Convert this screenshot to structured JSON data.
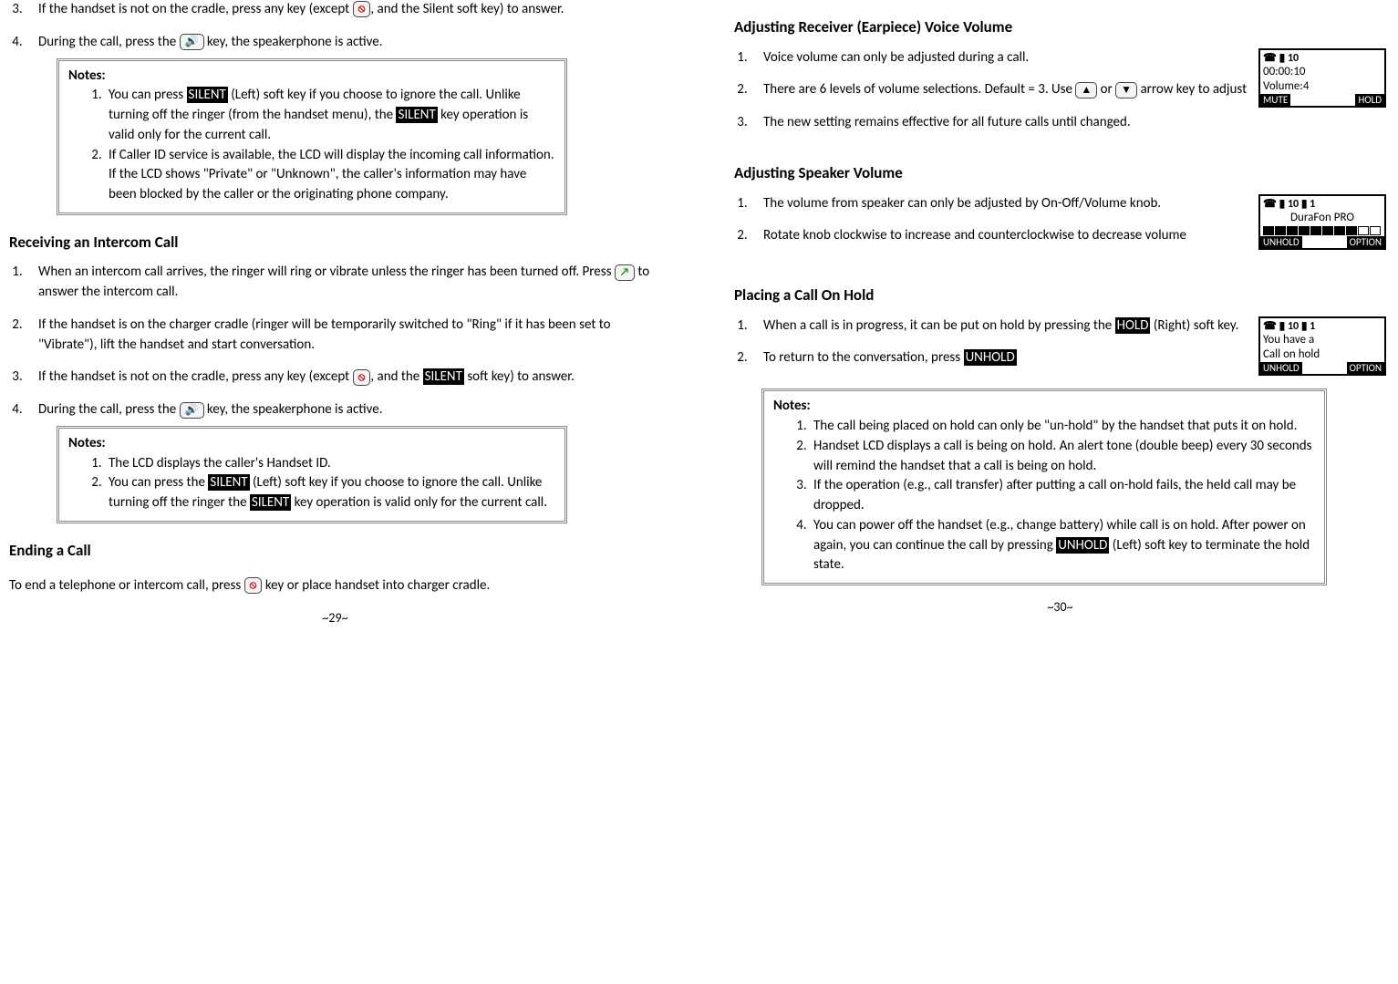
{
  "left": {
    "item3": {
      "pre": "If the handset is not on the cradle, press any key (except ",
      "post": ", and the Silent soft key) to answer."
    },
    "item4": {
      "pre": "During the call, press the ",
      "post": " key, the speakerphone is active."
    },
    "notes1": {
      "title": "Notes:",
      "i1a": "You can press ",
      "silent": "SILENT",
      "i1b": " (Left) soft key if you choose to ignore the call.  Unlike turning off the ringer (from the handset menu), the ",
      "i1c": " key operation is valid only for the current call.",
      "i2": "If Caller ID service is available, the LCD will display the incoming call information.  If the LCD shows \"Private\" or \"Unknown\", the caller's information may have been blocked by the caller or the originating phone company."
    },
    "h_intercom": "Receiving an Intercom Call",
    "ic1a": "When an intercom call arrives, the ringer will ring or vibrate unless the ringer has been turned off. Press ",
    "ic1b": " to answer the intercom call.",
    "ic2": "If the handset is on the charger cradle (ringer will be temporarily switched to \"Ring\" if it has been set to \"Vibrate\"), lift the handset and start conversation.",
    "ic3a": "If the handset is not on the cradle, press any key (except ",
    "ic3b": ", and the ",
    "ic3c": " soft key) to answer.",
    "ic4a": "During the call, press the ",
    "ic4b": " key, the speakerphone is active.",
    "notes2": {
      "title": "Notes:",
      "i1": "The LCD displays the caller's Handset ID.",
      "i2a": "You can press the ",
      "i2b": " (Left) soft key if you choose to ignore the call.  Unlike turning off the ringer the ",
      "i2c": " key operation is valid only for the current call."
    },
    "h_end": "Ending a Call",
    "end_a": "To end a telephone or intercom call, press ",
    "end_b": " key or place handset into charger cradle.",
    "foot": "~29~"
  },
  "right": {
    "h_recv": "Adjusting Receiver (Earpiece) Voice Volume",
    "r1": "Voice volume can only be adjusted during a call.",
    "r2a": "There are 6 levels of volume selections.  Default = 3. Use ",
    "r2b": " or ",
    "r2c": " arrow key to adjust",
    "r3": "The new setting remains effective for all future calls until changed.",
    "lcd1": {
      "top": "☎ ▮ 10",
      "l2": "00:00:10",
      "l3": "Volume:4",
      "skL": "MUTE",
      "skR": "HOLD"
    },
    "h_speak": "Adjusting Speaker Volume",
    "s1": "The volume from speaker can only be adjusted by On-Off/Volume knob.",
    "s2": "Rotate knob clockwise to increase and counterclockwise to decrease volume",
    "lcd2": {
      "top": "☎ ▮ 10 ▮ 1",
      "l2": "DuraFon PRO",
      "skL": "UNHOLD",
      "skR": "OPTION"
    },
    "h_hold": "Placing a Call On Hold",
    "h1a": "When a call is in progress, it can be put on hold by pressing the ",
    "hold": "HOLD",
    "h1b": " (Right) soft key.",
    "h2a": "To return to the conversation, press ",
    "unhold": "UNHOLD",
    "lcd3": {
      "top": "☎ ▮ 10 ▮ 1",
      "l2": "You have a",
      "l3": "Call on hold",
      "skL": "UNHOLD",
      "skR": "OPTION"
    },
    "notes3": {
      "title": "Notes:",
      "i1": "The call being placed on hold can only be \"un-hold\" by the handset that puts it on hold.",
      "i2": "Handset LCD displays a call is being on hold.  An alert tone (double beep) every 30 seconds will remind the handset that a call is being on hold.",
      "i3": "If the operation (e.g., call transfer) after putting a call on-hold fails, the held call may be dropped.",
      "i4a": "You can power off the handset (e.g., change battery) while call is on hold.  After power on again, you can continue the call by pressing ",
      "i4b": " (Left) soft key to terminate the hold state."
    },
    "foot": "~30~"
  },
  "icons": {
    "end": "⦸",
    "spk": "🔊",
    "talk": "↗",
    "up": "▲",
    "down": "▼"
  }
}
